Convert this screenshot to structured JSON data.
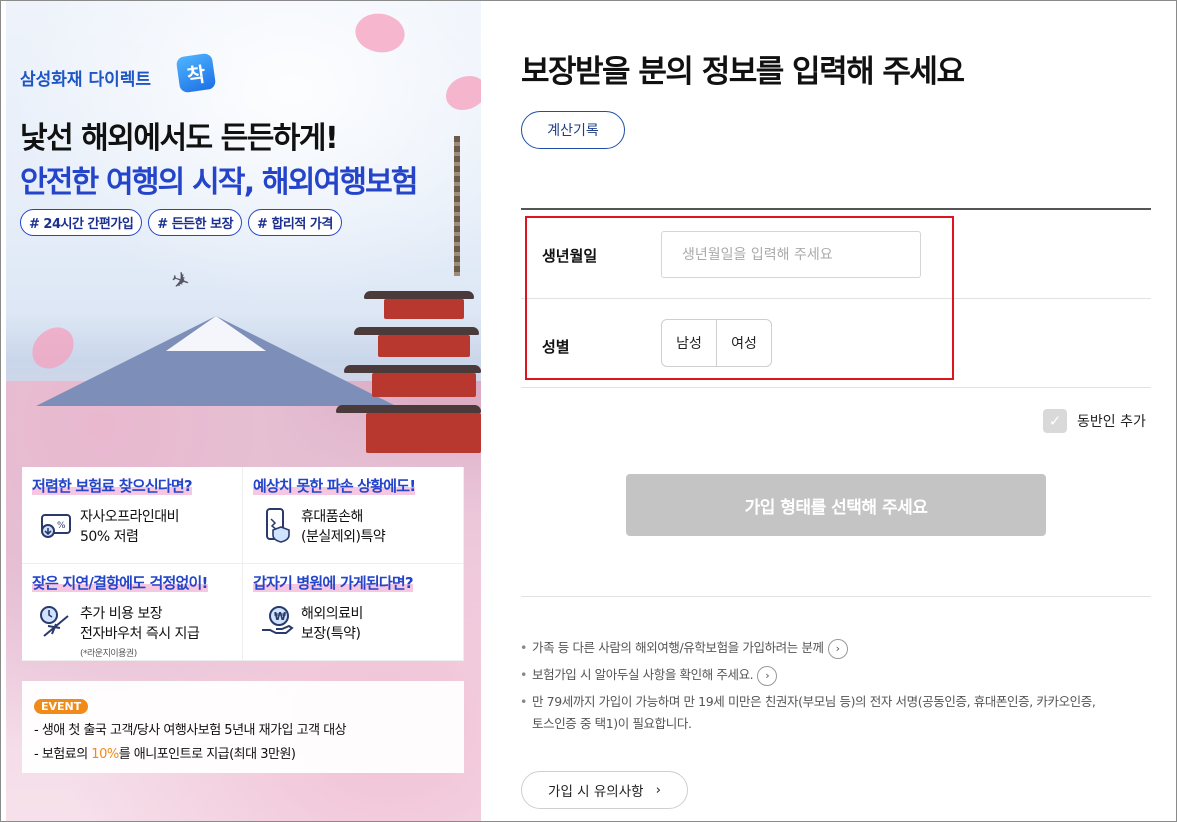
{
  "banner": {
    "brand": "삼성화재 다이렉트",
    "brand_badge": "착",
    "headline1": "낯선 해외에서도 든든하게!",
    "headline2": "안전한 여행의 시작, 해외여행보험",
    "tags": [
      "# 24시간 간편가입",
      "# 든든한 보장",
      "# 합리적 가격"
    ],
    "features": [
      {
        "title": "저렴한 보험료 찾으신다면?",
        "line1": "자사오프라인대비",
        "line2": "50% 저렴",
        "note": "",
        "icon": "discount-icon"
      },
      {
        "title": "예상치 못한 파손 상황에도!",
        "line1": "휴대품손해",
        "line2": "(분실제외)특약",
        "note": "",
        "icon": "broken-phone-shield-icon"
      },
      {
        "title": "잦은 지연/결항에도 걱정없이!",
        "line1": "추가 비용 보장",
        "line2": "전자바우처 즉시 지급",
        "note": "(*라운지이용권)",
        "icon": "airplane-clock-icon"
      },
      {
        "title": "갑자기 병원에 가게된다면?",
        "line1": "해외의료비",
        "line2": "보장(특약)",
        "note": "",
        "icon": "hand-coin-icon"
      }
    ],
    "event": {
      "badge": "EVENT",
      "line1": "- 생애 첫 출국 고객/당사 여행사보험 5년내 재가입 고객 대상",
      "line2_pre": "- 보험료의 ",
      "line2_highlight": "10%",
      "line2_post": "를 애니포인트로 지급(최대 3만원)"
    }
  },
  "form": {
    "title": "보장받을 분의 정보를 입력해 주세요",
    "calc_history_label": "계산기록",
    "birth_label": "생년월일",
    "birth_placeholder": "생년월일을 입력해 주세요",
    "birth_value": "",
    "gender_label": "성별",
    "gender_male": "남성",
    "gender_female": "여성",
    "companion_label": "동반인 추가",
    "companion_checked": false,
    "submit_label": "가입 형태를 선택해 주세요",
    "notes": [
      {
        "text": "가족 등 다른 사람의 해외여행/유학보험을 가입하려는 분께",
        "has_arrow": true
      },
      {
        "text": "보험가입 시 알아두실 사항을 확인해 주세요.",
        "has_arrow": true
      },
      {
        "text": "만 79세까지 가입이 가능하며 만 19세 미만은 친권자(부모님 등)의 전자 서명(공동인증, 휴대폰인증, 카카오인증,",
        "text2": "토스인증 중 택1)이 필요합니다.",
        "has_arrow": false
      }
    ],
    "caution_label": "가입 시 유의사항"
  },
  "colors": {
    "brand_blue": "#2444c9",
    "highlight_border": "#e0141e",
    "disabled_button": "#c4c4c4",
    "event_orange": "#f08a18"
  }
}
